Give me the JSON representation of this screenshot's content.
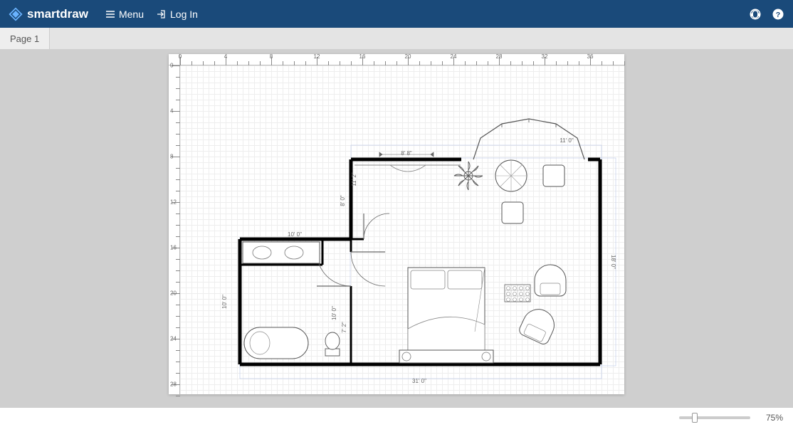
{
  "header": {
    "brand": "smartdraw",
    "menu_label": "Menu",
    "login_label": "Log In"
  },
  "tabs": [
    {
      "label": "Page 1"
    }
  ],
  "ruler_h": [
    "0",
    "4",
    "8",
    "12",
    "16",
    "20",
    "24",
    "28",
    "32",
    "36"
  ],
  "ruler_v": [
    "0",
    "4",
    "8",
    "12",
    "16",
    "20",
    "24",
    "28"
  ],
  "dimensions": {
    "bottom_width": "31' 0\"",
    "right_height": "18' 0\"",
    "bay_window": "11' 0\"",
    "top_opening": "8' 8\"",
    "left_closet_h": "11' 2\"",
    "left_wall_h": "8' 0\"",
    "bath_hall_w": "10' 0\"",
    "bath_h": "10' 0\"",
    "bath_left_h": "10' 0\"",
    "door_h": "7' 2\""
  },
  "footer": {
    "zoom": "75%"
  }
}
